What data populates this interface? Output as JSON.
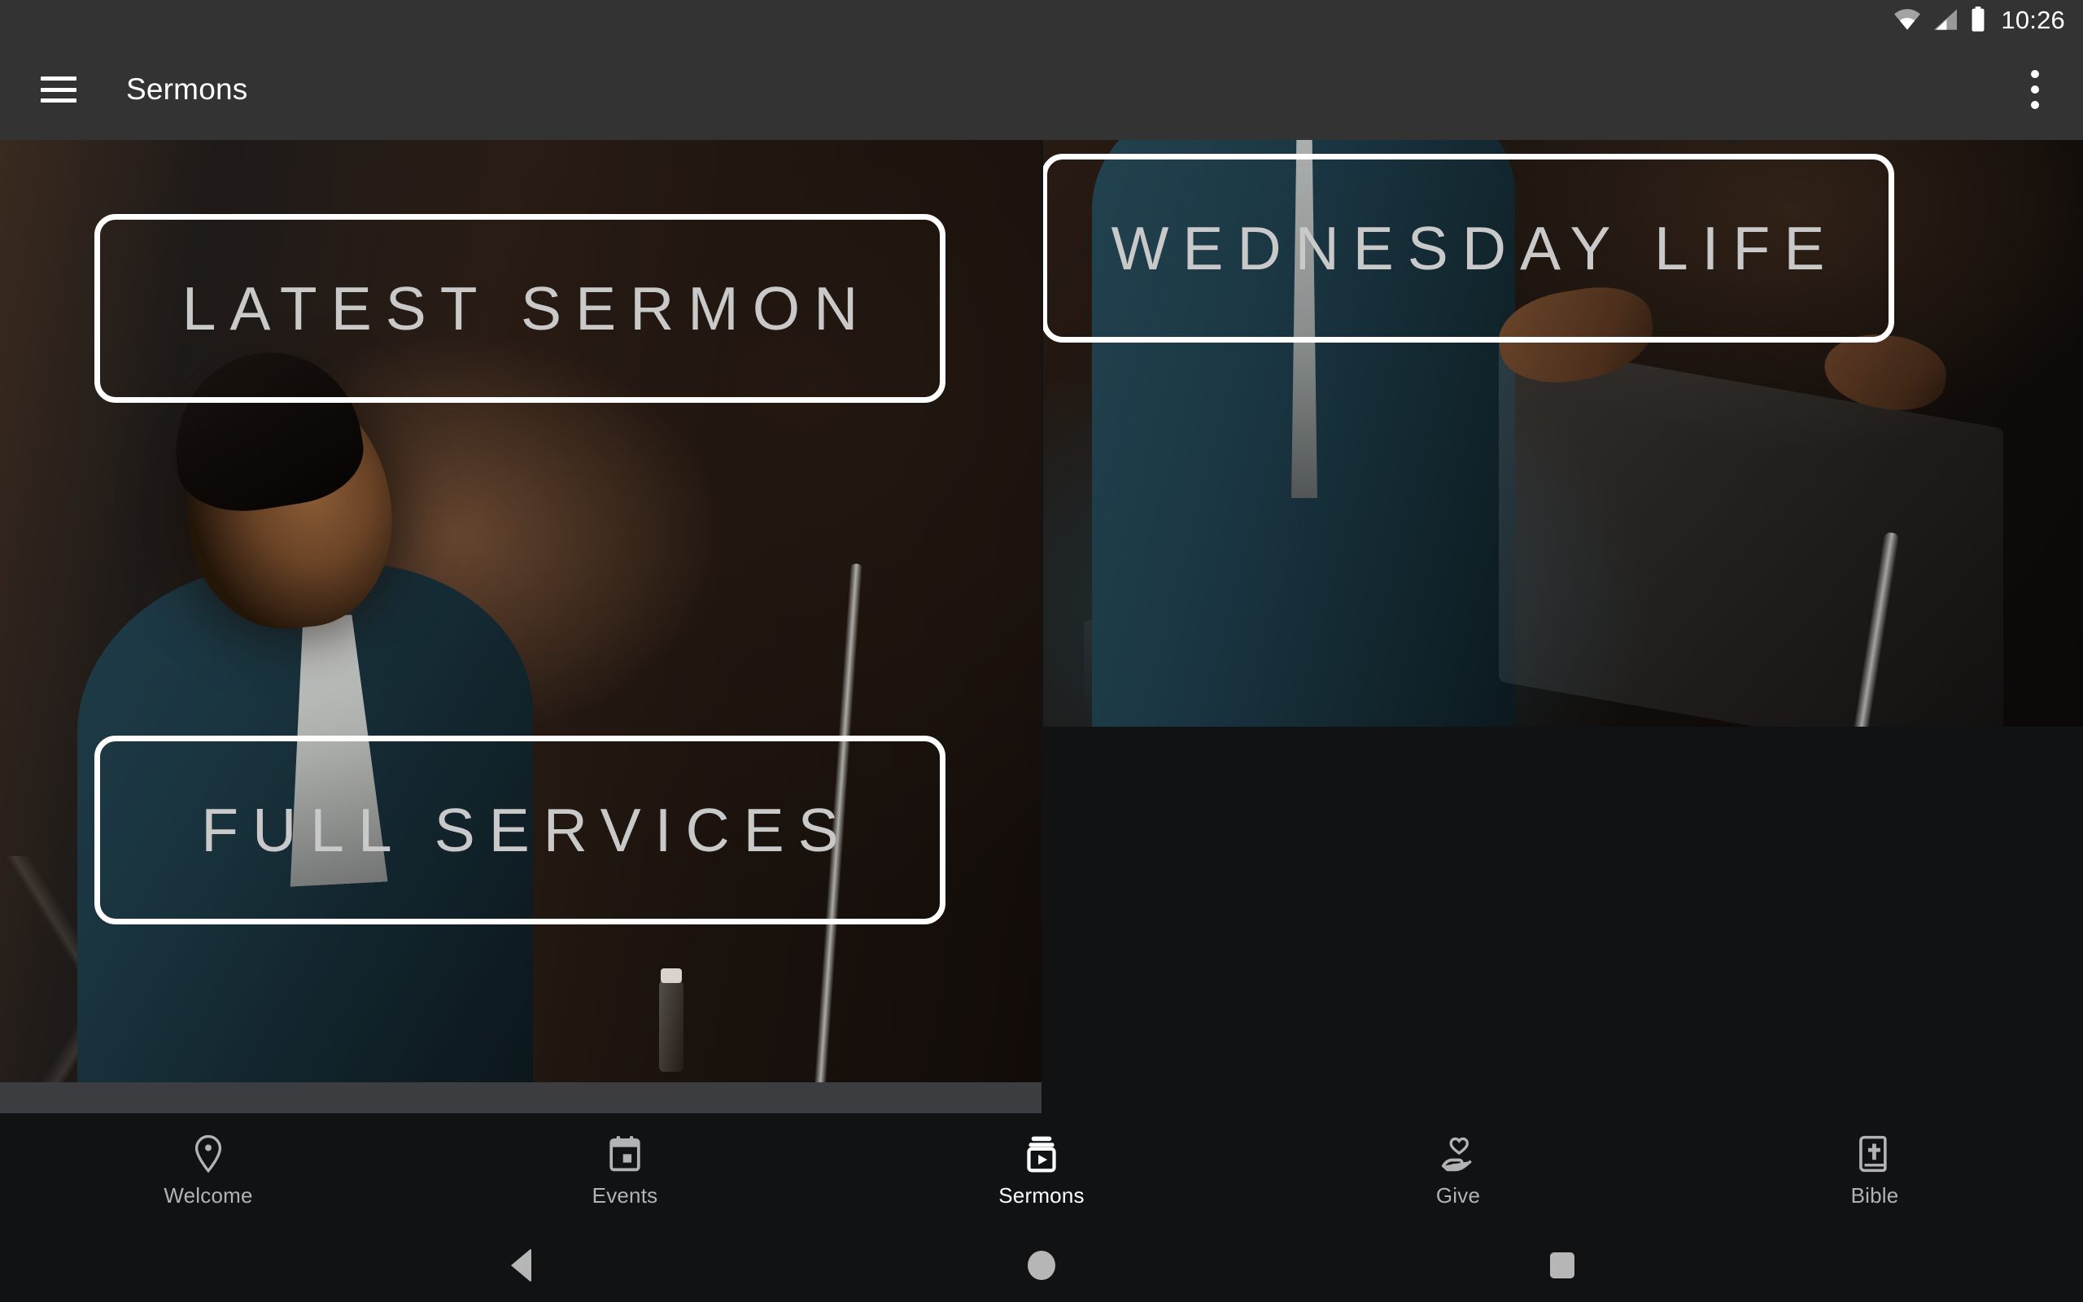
{
  "statusbar": {
    "time": "10:26",
    "icons": [
      "wifi-icon",
      "cellular-signal-icon",
      "battery-icon"
    ]
  },
  "appbar": {
    "menu_icon": "hamburger-menu-icon",
    "title": "Sermons",
    "overflow_icon": "overflow-menu-icon"
  },
  "tiles": [
    {
      "id": "latest-sermon",
      "label": "LATEST SERMON"
    },
    {
      "id": "wednesday-life",
      "label": "WEDNESDAY LIFE"
    },
    {
      "id": "full-services",
      "label": "FULL SERVICES"
    }
  ],
  "tabbar": {
    "items": [
      {
        "label": "Welcome",
        "icon": "location-pin-icon",
        "active": false
      },
      {
        "label": "Events",
        "icon": "calendar-icon",
        "active": false
      },
      {
        "label": "Sermons",
        "icon": "video-library-icon",
        "active": true
      },
      {
        "label": "Give",
        "icon": "hand-heart-icon",
        "active": false
      },
      {
        "label": "Bible",
        "icon": "bible-book-icon",
        "active": false
      }
    ]
  },
  "navbar": {
    "back": "back-triangle-icon",
    "home": "home-circle-icon",
    "recents": "recents-square-icon"
  },
  "colors": {
    "appbar_bg": "#333333",
    "page_bg": "#111214",
    "label_border": "#ffffff",
    "label_text": "#c9c9c9",
    "tab_active": "#ffffff",
    "tab_inactive": "#b3b3b3"
  }
}
